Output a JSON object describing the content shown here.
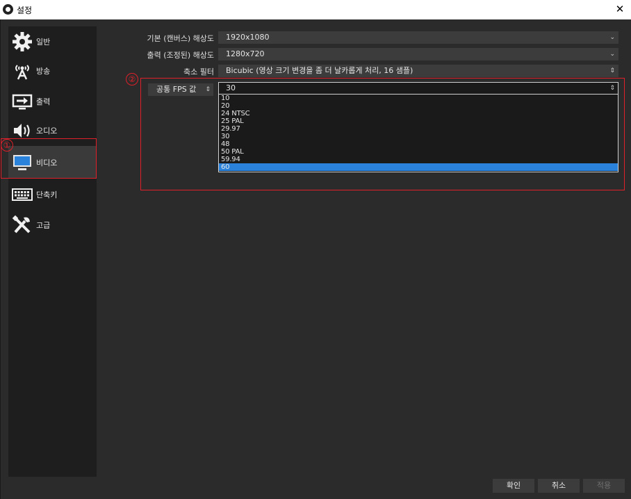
{
  "window": {
    "title": "설정",
    "close_glyph": "✕"
  },
  "sidebar": {
    "items": [
      {
        "label": "일반",
        "icon": "gear-icon"
      },
      {
        "label": "방송",
        "icon": "broadcast-icon"
      },
      {
        "label": "출력",
        "icon": "output-icon"
      },
      {
        "label": "오디오",
        "icon": "speaker-icon"
      },
      {
        "label": "비디오",
        "icon": "monitor-icon",
        "active": true
      },
      {
        "label": "단축키",
        "icon": "keyboard-icon"
      },
      {
        "label": "고급",
        "icon": "tools-icon"
      }
    ]
  },
  "video": {
    "base_resolution": {
      "label": "기본 (캔버스) 해상도",
      "value": "1920x1080"
    },
    "output_resolution": {
      "label": "출력 (조정된) 해상도",
      "value": "1280x720"
    },
    "downscale_filter": {
      "label": "축소 필터",
      "value": "Bicubic (영상 크기 변경을 좀 더 날카롭게 처리, 16 샘플)"
    },
    "fps": {
      "type_label": "공통 FPS 값",
      "value": "30",
      "options": [
        "10",
        "20",
        "24 NTSC",
        "25 PAL",
        "29.97",
        "30",
        "48",
        "50 PAL",
        "59.94",
        "60"
      ],
      "highlighted": "60"
    }
  },
  "annotations": {
    "marker1": "①",
    "marker2": "②"
  },
  "buttons": {
    "ok": "확인",
    "cancel": "취소",
    "apply": "적용"
  },
  "colors": {
    "accent": "#2a82da",
    "highlight_box": "#e0202a"
  }
}
